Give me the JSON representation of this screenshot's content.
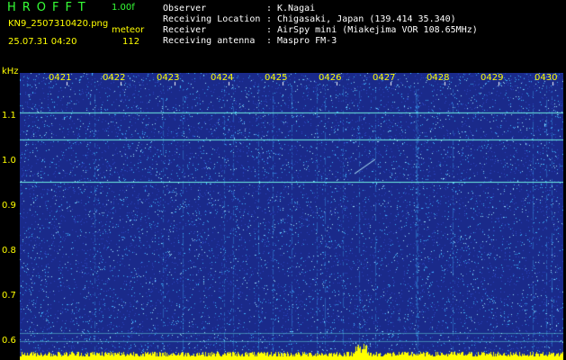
{
  "header": {
    "app_name": "HROFFT",
    "version": "1.00f",
    "file_name": "KN9_2507310420.png",
    "mode": "meteor",
    "datetime": "25.07.31 04:20",
    "count": "112"
  },
  "info": [
    {
      "label": "Observer",
      "value": "K.Nagai"
    },
    {
      "label": "Receiving Location",
      "value": "Chigasaki, Japan (139.414 35.340)"
    },
    {
      "label": "Receiver",
      "value": "AirSpy mini (Miakejima VOR 108.65MHz)"
    },
    {
      "label": "Receiving antenna",
      "value": "Maspro FM-3"
    }
  ],
  "separator": ":",
  "plot": {
    "unit": "kHz",
    "y_ticks": [
      "1.1",
      "1.0",
      "0.9",
      "0.8",
      "0.7",
      "0.6"
    ],
    "x_ticks": [
      "0421",
      "0422",
      "0423",
      "0424",
      "0425",
      "0426",
      "0427",
      "0428",
      "0429",
      "0430"
    ],
    "colors": {
      "background": "#1a2a8a",
      "noise": "#3fb6ff",
      "carrier": "#6ff0e0",
      "baseline": "#ffff00"
    }
  }
}
